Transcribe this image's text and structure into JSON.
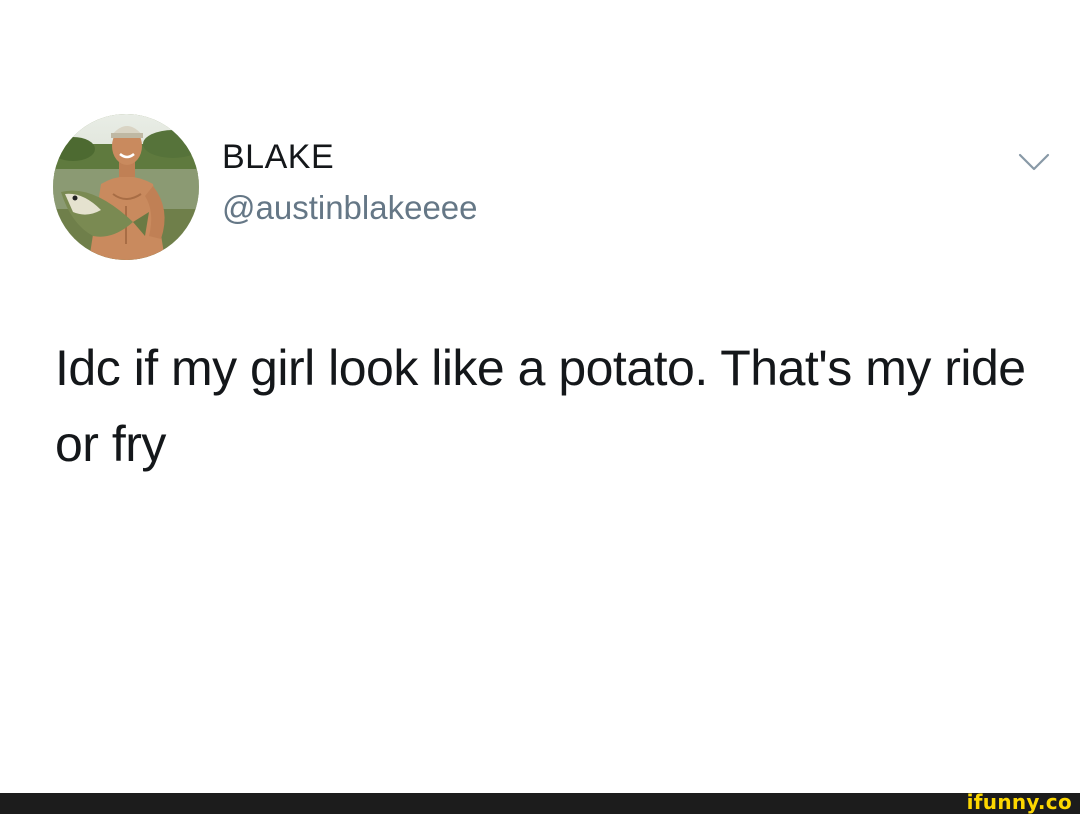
{
  "tweet": {
    "display_name": "BLAKE",
    "handle": "@austinblakeeee",
    "text": "Idc if my girl look like a potato. That's my ride or fry",
    "avatar_icon": "profile-photo",
    "menu_icon": "chevron-down-icon"
  },
  "footer": {
    "watermark": "ifunny.co",
    "watermark_color": "#fdd700",
    "bar_color": "#1c1c1c"
  },
  "colors": {
    "text_primary": "#14171a",
    "text_secondary": "#657786",
    "chevron": "#8899a6"
  }
}
